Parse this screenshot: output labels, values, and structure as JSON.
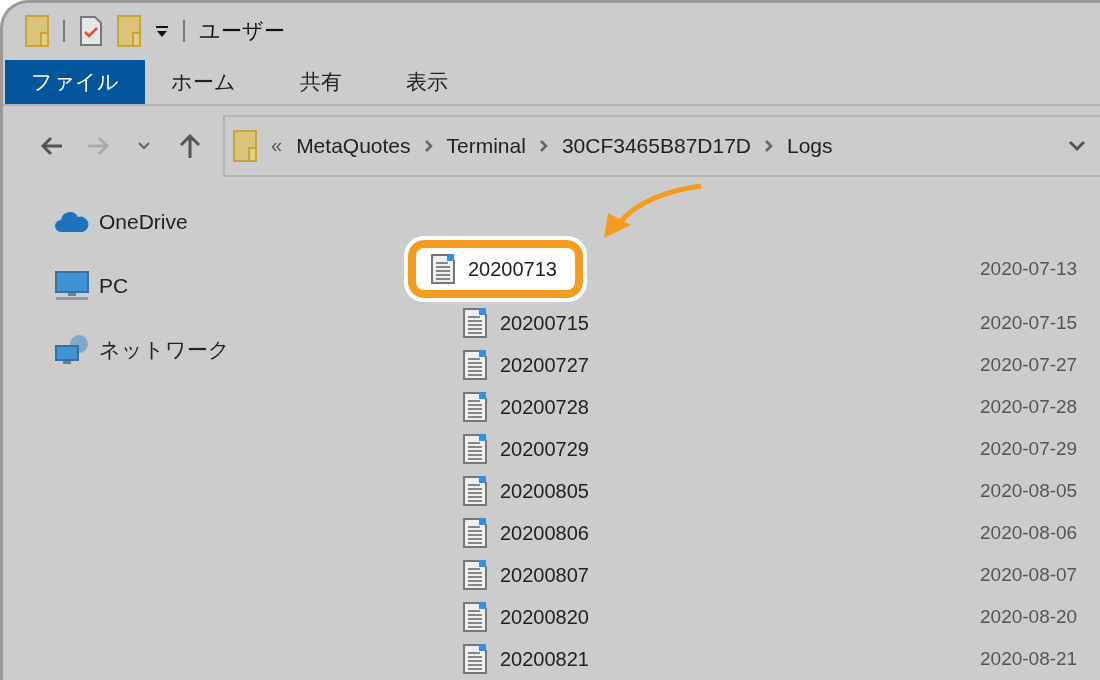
{
  "window": {
    "title": "ユーザー"
  },
  "ribbon_tabs": [
    {
      "label": "ファイル",
      "selected": true
    },
    {
      "label": "ホーム",
      "selected": false
    },
    {
      "label": "共有",
      "selected": false
    },
    {
      "label": "表示",
      "selected": false
    }
  ],
  "address": {
    "overflow": "«",
    "path": [
      "MetaQuotes",
      "Terminal",
      "30CF3465B87D17D",
      "Logs"
    ]
  },
  "sidebar": {
    "items": [
      {
        "label": "OneDrive",
        "kind": "cloud"
      },
      {
        "label": "PC",
        "kind": "pc"
      },
      {
        "label": "ネットワーク",
        "kind": "network"
      }
    ]
  },
  "files": [
    {
      "name": "20200713",
      "date": "2020-07-13",
      "highlighted": true
    },
    {
      "name": "20200715",
      "date": "2020-07-15",
      "highlighted": false
    },
    {
      "name": "20200727",
      "date": "2020-07-27",
      "highlighted": false
    },
    {
      "name": "20200728",
      "date": "2020-07-28",
      "highlighted": false
    },
    {
      "name": "20200729",
      "date": "2020-07-29",
      "highlighted": false
    },
    {
      "name": "20200805",
      "date": "2020-08-05",
      "highlighted": false
    },
    {
      "name": "20200806",
      "date": "2020-08-06",
      "highlighted": false
    },
    {
      "name": "20200807",
      "date": "2020-08-07",
      "highlighted": false
    },
    {
      "name": "20200820",
      "date": "2020-08-20",
      "highlighted": false
    },
    {
      "name": "20200821",
      "date": "2020-08-21",
      "highlighted": false
    }
  ]
}
